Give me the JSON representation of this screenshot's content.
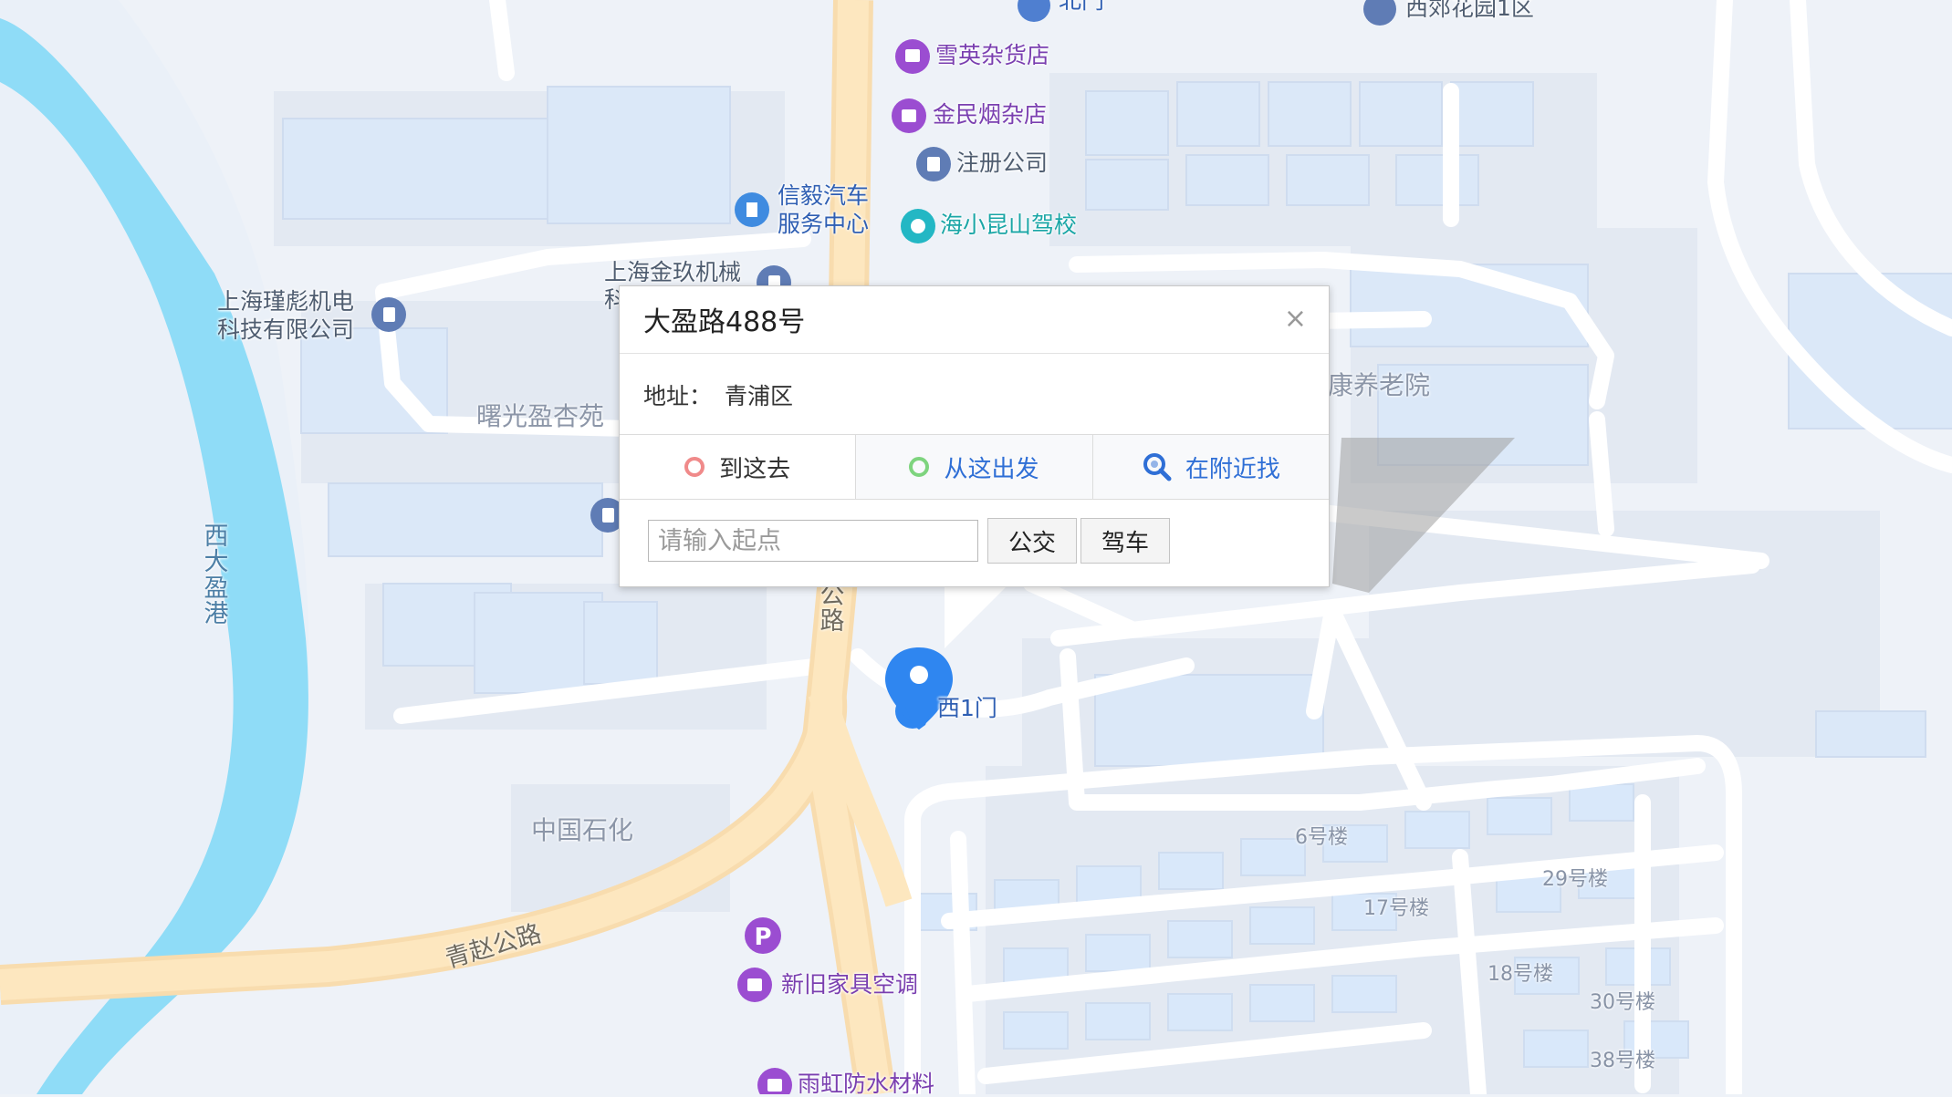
{
  "popup": {
    "title": "大盈路488号",
    "close": "×",
    "address_key": "地址：",
    "address_value": "青浦区",
    "actions": [
      {
        "label": "到这去",
        "icon": "red-ring-icon"
      },
      {
        "label": "从这出发",
        "icon": "green-ring-icon"
      },
      {
        "label": "在附近找",
        "icon": "magnifier-icon"
      }
    ],
    "start_placeholder": "请输入起点",
    "bus_button": "公交",
    "drive_button": "驾车"
  },
  "map": {
    "poi": {
      "gate_top": "北门",
      "xijiao": "西郊花园1区",
      "xueying": "雪英杂货店",
      "jinmin": "金民烟杂店",
      "zhuce": "注册公司",
      "xinyi_1": "信毅汽车",
      "xinyi_2": "服务中心",
      "haixiao": "海小昆山驾校",
      "jinjiu_1": "上海金玖机械",
      "jinjiu_2": "科",
      "jinbin_1": "上海瑾彪机电",
      "jinbin_2": "科技有限公司",
      "gate_west": "西1门",
      "jiaju": "新旧家具空调",
      "yuhong": "雨虹防水材料",
      "parking": "P"
    },
    "areas": {
      "shuguang": "曙光盈杏苑",
      "kangyang": "康养老院",
      "zhongguo": "中国石化"
    },
    "river": [
      "西",
      "大",
      "盈",
      "港"
    ],
    "roads": {
      "qingzhao": "青赵公路",
      "vertical_road": [
        "公",
        "路"
      ]
    },
    "buildings": {
      "b6": "6号楼",
      "b29": "29号楼",
      "b17": "17号楼",
      "b18": "18号楼",
      "b30": "30号楼",
      "b38": "38号楼"
    },
    "colors": {
      "river": "#8fdcf7",
      "main_road": "#fde2ad",
      "minor_road": "#ffffff",
      "building": "#dde9f7",
      "poi_purple": "#9b4dd1",
      "poi_teal": "#23b7c4",
      "marker": "#2f86f0"
    }
  }
}
